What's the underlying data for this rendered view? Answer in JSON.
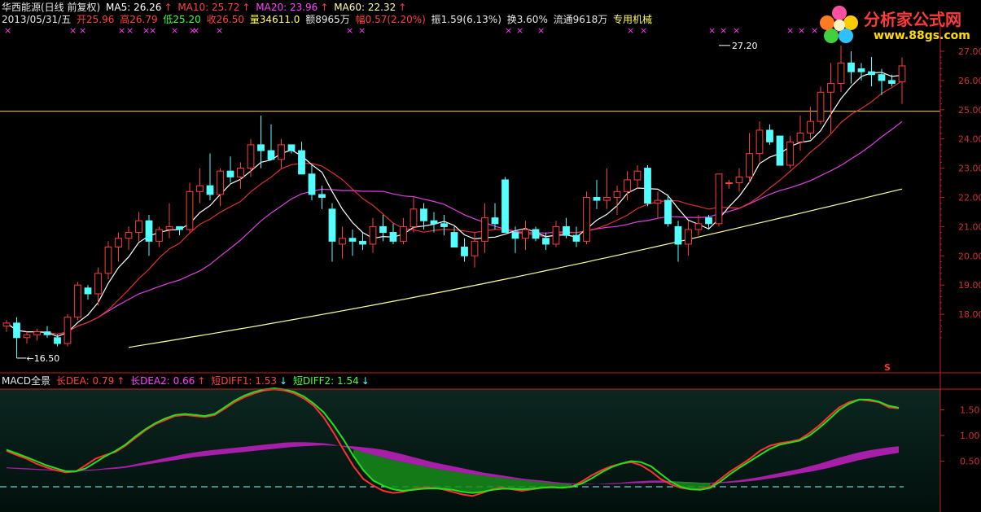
{
  "header": {
    "title": "华西能源(日线 前复权)",
    "ma5": "MA5: 26.26",
    "ma10": "MA10: 25.72",
    "ma20": "MA20: 23.96",
    "ma60": "MA60: 22.32",
    "date": "2013/05/31/五",
    "open": "开25.96",
    "high": "高26.79",
    "low": "低25.20",
    "close": "收26.50",
    "volume": "量34611.0",
    "amount": "额8965万",
    "change": "幅0.57(2.20%)",
    "amplitude": "振1.59(6.13%)",
    "turnover": "换3.60%",
    "float": "流通9618万",
    "sector": "专用机械"
  },
  "macd_header": {
    "title": "MACD全景",
    "long_dea": "长DEA: 0.79",
    "long_dea2": "长DEA2: 0.66",
    "short_diff1": "短DIFF1: 1.53",
    "short_diff2": "短DIFF2: 1.54"
  },
  "watermark": {
    "text": "分析家公式网",
    "url": "www.88gs.com"
  },
  "annotations": {
    "high_label": "27.20",
    "low_label": "16.50",
    "signal_mark": "S"
  },
  "colors": {
    "up": "#ff3c3c",
    "down": "#54ffff",
    "ma5": "#ffffff",
    "ma10": "#e03030",
    "ma20": "#e040e0",
    "ma60": "#ffffa0",
    "level_line": "#ffcc66",
    "axis": "#c02020",
    "diff1": "#ff3030",
    "diff2": "#20e020",
    "dea_long": "#b020b0",
    "zero_line": "#80ffff"
  },
  "chart_data": [
    {
      "type": "candlestick",
      "title": "华西能源(日线 前复权)",
      "ylim": [
        16.0,
        27.5
      ],
      "yticks": [
        "27.00",
        "26.00",
        "25.00",
        "24.00",
        "23.00",
        "22.00",
        "21.00",
        "20.00",
        "19.00",
        "18.00"
      ],
      "ytick_values": [
        27,
        26,
        25,
        24,
        23,
        22,
        21,
        20,
        19,
        18
      ],
      "horizontal_level": 24.95,
      "high_marker": {
        "index": 70,
        "value": 27.2
      },
      "low_marker": {
        "index": 1,
        "value": 16.5
      },
      "candles": [
        [
          17.6,
          17.8,
          17.4,
          17.7
        ],
        [
          17.7,
          17.9,
          16.5,
          17.2
        ],
        [
          17.2,
          17.4,
          17.0,
          17.3
        ],
        [
          17.3,
          17.5,
          17.1,
          17.4
        ],
        [
          17.4,
          17.6,
          17.2,
          17.3
        ],
        [
          17.2,
          17.3,
          16.9,
          17.0
        ],
        [
          17.0,
          18.0,
          16.9,
          17.9
        ],
        [
          17.9,
          19.1,
          17.8,
          19.0
        ],
        [
          18.9,
          19.0,
          18.5,
          18.7
        ],
        [
          18.7,
          19.6,
          18.3,
          19.4
        ],
        [
          19.4,
          20.5,
          19.2,
          20.3
        ],
        [
          20.3,
          20.8,
          19.8,
          20.6
        ],
        [
          20.6,
          21.0,
          20.2,
          20.8
        ],
        [
          20.8,
          21.5,
          20.5,
          21.2
        ],
        [
          21.2,
          21.4,
          20.0,
          20.5
        ],
        [
          20.5,
          21.0,
          20.3,
          20.9
        ],
        [
          20.9,
          21.8,
          20.6,
          21.0
        ],
        [
          21.0,
          21.0,
          20.7,
          20.9
        ],
        [
          20.9,
          22.5,
          20.8,
          22.2
        ],
        [
          22.2,
          23.0,
          21.8,
          22.4
        ],
        [
          22.4,
          23.5,
          21.9,
          22.1
        ],
        [
          22.1,
          23.0,
          21.7,
          22.9
        ],
        [
          22.9,
          23.4,
          22.5,
          22.7
        ],
        [
          22.7,
          23.2,
          22.3,
          23.0
        ],
        [
          23.0,
          24.0,
          22.7,
          23.8
        ],
        [
          23.8,
          24.8,
          23.0,
          23.6
        ],
        [
          23.6,
          24.5,
          23.3,
          23.3
        ],
        [
          23.3,
          24.0,
          23.0,
          23.8
        ],
        [
          23.8,
          23.8,
          23.5,
          23.6
        ],
        [
          23.6,
          23.9,
          22.8,
          22.8
        ],
        [
          22.8,
          23.1,
          21.9,
          22.1
        ],
        [
          22.1,
          22.4,
          21.6,
          22.0
        ],
        [
          21.6,
          21.8,
          19.8,
          20.5
        ],
        [
          20.4,
          21.0,
          19.9,
          20.6
        ],
        [
          20.6,
          20.9,
          20.0,
          20.5
        ],
        [
          20.5,
          20.8,
          20.2,
          20.4
        ],
        [
          20.4,
          21.3,
          20.1,
          21.0
        ],
        [
          21.0,
          21.4,
          20.5,
          20.8
        ],
        [
          20.8,
          21.1,
          20.4,
          20.5
        ],
        [
          20.5,
          21.3,
          20.4,
          21.0
        ],
        [
          21.0,
          22.0,
          20.8,
          21.6
        ],
        [
          21.6,
          21.8,
          20.9,
          21.2
        ],
        [
          21.2,
          21.5,
          20.8,
          21.1
        ],
        [
          21.1,
          21.4,
          20.7,
          21.0
        ],
        [
          20.8,
          21.0,
          20.3,
          20.3
        ],
        [
          20.3,
          20.6,
          19.8,
          20.0
        ],
        [
          20.0,
          20.8,
          19.6,
          20.5
        ],
        [
          20.5,
          21.8,
          20.1,
          21.3
        ],
        [
          21.3,
          21.8,
          20.9,
          21.1
        ],
        [
          22.6,
          22.7,
          20.8,
          20.8
        ],
        [
          20.8,
          21.0,
          20.1,
          20.6
        ],
        [
          20.6,
          21.2,
          20.2,
          20.9
        ],
        [
          20.9,
          21.0,
          20.5,
          20.6
        ],
        [
          20.6,
          20.8,
          20.2,
          20.4
        ],
        [
          20.4,
          21.2,
          20.3,
          21.0
        ],
        [
          21.0,
          21.3,
          20.6,
          20.7
        ],
        [
          20.7,
          21.0,
          20.3,
          20.5
        ],
        [
          20.5,
          22.2,
          20.4,
          22.0
        ],
        [
          22.0,
          22.6,
          21.6,
          21.9
        ],
        [
          21.9,
          23.0,
          21.6,
          22.0
        ],
        [
          22.0,
          22.4,
          21.4,
          22.2
        ],
        [
          22.2,
          22.9,
          21.9,
          22.6
        ],
        [
          22.6,
          23.1,
          22.3,
          22.9
        ],
        [
          23.0,
          23.1,
          21.7,
          21.8
        ],
        [
          21.8,
          22.2,
          21.3,
          21.9
        ],
        [
          21.9,
          22.1,
          21.0,
          21.1
        ],
        [
          21.0,
          21.2,
          19.8,
          20.4
        ],
        [
          20.4,
          21.2,
          20.0,
          20.9
        ],
        [
          20.9,
          21.4,
          20.7,
          21.1
        ],
        [
          21.3,
          21.4,
          20.9,
          21.1
        ],
        [
          21.1,
          22.8,
          21.0,
          22.8
        ],
        [
          22.5,
          22.6,
          22.3,
          22.5
        ],
        [
          22.5,
          23.0,
          22.2,
          22.7
        ],
        [
          22.7,
          24.2,
          22.5,
          23.5
        ],
        [
          23.5,
          24.6,
          23.2,
          24.3
        ],
        [
          24.3,
          24.5,
          23.8,
          23.9
        ],
        [
          24.1,
          24.1,
          23.1,
          23.1
        ],
        [
          23.1,
          24.1,
          23.0,
          23.9
        ],
        [
          23.9,
          24.8,
          23.6,
          24.2
        ],
        [
          24.2,
          25.1,
          24.0,
          24.6
        ],
        [
          24.6,
          25.8,
          24.5,
          25.6
        ],
        [
          25.6,
          26.6,
          24.2,
          25.9
        ],
        [
          25.9,
          27.2,
          25.6,
          26.6
        ],
        [
          26.6,
          27.0,
          25.9,
          26.3
        ],
        [
          26.4,
          26.6,
          26.0,
          26.3
        ],
        [
          26.3,
          26.8,
          25.8,
          26.2
        ],
        [
          26.2,
          26.4,
          25.5,
          26.0
        ],
        [
          26.0,
          26.2,
          25.8,
          25.9
        ],
        [
          25.96,
          26.79,
          25.2,
          26.5
        ]
      ],
      "series": [
        {
          "name": "MA5"
        },
        {
          "name": "MA10"
        },
        {
          "name": "MA20"
        },
        {
          "name": "MA60"
        }
      ]
    },
    {
      "type": "line",
      "title": "MACD全景",
      "ylim": [
        -0.2,
        2.0
      ],
      "yticks": [
        "1.50",
        "1.00",
        "0.50"
      ],
      "ytick_values": [
        1.5,
        1.0,
        0.5
      ],
      "zero_line": 0.0,
      "series": [
        {
          "name": "短DIFF1",
          "values": [
            0.7,
            0.62,
            0.55,
            0.45,
            0.38,
            0.32,
            0.28,
            0.3,
            0.42,
            0.55,
            0.62,
            0.68,
            0.8,
            0.95,
            1.1,
            1.22,
            1.3,
            1.38,
            1.4,
            1.38,
            1.36,
            1.4,
            1.52,
            1.65,
            1.75,
            1.82,
            1.88,
            1.9,
            1.88,
            1.82,
            1.72,
            1.58,
            1.35,
            1.05,
            0.72,
            0.4,
            0.15,
            0.02,
            -0.08,
            -0.12,
            -0.1,
            -0.05,
            -0.02,
            -0.02,
            -0.05,
            -0.1,
            -0.15,
            -0.18,
            -0.12,
            -0.05,
            -0.02,
            -0.05,
            -0.08,
            -0.05,
            -0.02,
            0.0,
            -0.02,
            0.0,
            0.1,
            0.22,
            0.32,
            0.4,
            0.45,
            0.48,
            0.42,
            0.3,
            0.15,
            0.05,
            -0.02,
            -0.05,
            -0.05,
            0.0,
            0.15,
            0.3,
            0.42,
            0.55,
            0.7,
            0.8,
            0.85,
            0.88,
            0.92,
            1.05,
            1.2,
            1.38,
            1.55,
            1.65,
            1.7,
            1.68,
            1.65,
            1.55,
            1.53
          ]
        },
        {
          "name": "短DIFF2",
          "values": [
            0.72,
            0.65,
            0.58,
            0.5,
            0.42,
            0.36,
            0.3,
            0.3,
            0.36,
            0.48,
            0.6,
            0.7,
            0.82,
            0.98,
            1.12,
            1.24,
            1.33,
            1.4,
            1.42,
            1.4,
            1.38,
            1.42,
            1.55,
            1.68,
            1.78,
            1.85,
            1.9,
            1.92,
            1.9,
            1.85,
            1.76,
            1.62,
            1.45,
            1.2,
            0.92,
            0.6,
            0.32,
            0.12,
            0.02,
            -0.05,
            -0.08,
            -0.06,
            -0.04,
            -0.03,
            -0.04,
            -0.06,
            -0.1,
            -0.12,
            -0.1,
            -0.06,
            -0.04,
            -0.04,
            -0.05,
            -0.04,
            -0.02,
            -0.01,
            -0.02,
            0.0,
            0.06,
            0.16,
            0.28,
            0.38,
            0.45,
            0.5,
            0.48,
            0.4,
            0.25,
            0.1,
            0.0,
            -0.05,
            -0.06,
            -0.02,
            0.1,
            0.25,
            0.38,
            0.5,
            0.62,
            0.74,
            0.82,
            0.86,
            0.9,
            1.0,
            1.15,
            1.32,
            1.5,
            1.62,
            1.7,
            1.7,
            1.66,
            1.58,
            1.54
          ]
        },
        {
          "name": "长DEA",
          "values": [
            0.38,
            0.37,
            0.36,
            0.35,
            0.34,
            0.33,
            0.32,
            0.32,
            0.33,
            0.34,
            0.36,
            0.38,
            0.4,
            0.44,
            0.48,
            0.52,
            0.56,
            0.6,
            0.64,
            0.67,
            0.7,
            0.72,
            0.74,
            0.76,
            0.78,
            0.8,
            0.82,
            0.84,
            0.86,
            0.87,
            0.87,
            0.86,
            0.85,
            0.82,
            0.78,
            0.73,
            0.67,
            0.62,
            0.57,
            0.52,
            0.48,
            0.44,
            0.4,
            0.36,
            0.33,
            0.3,
            0.27,
            0.24,
            0.22,
            0.19,
            0.17,
            0.15,
            0.13,
            0.11,
            0.09,
            0.07,
            0.06,
            0.05,
            0.05,
            0.05,
            0.06,
            0.07,
            0.08,
            0.1,
            0.11,
            0.12,
            0.12,
            0.11,
            0.1,
            0.09,
            0.08,
            0.08,
            0.09,
            0.11,
            0.13,
            0.16,
            0.19,
            0.23,
            0.27,
            0.31,
            0.35,
            0.4,
            0.45,
            0.51,
            0.57,
            0.62,
            0.67,
            0.71,
            0.74,
            0.77,
            0.79
          ]
        },
        {
          "name": "长DEA2",
          "values": [
            0.36,
            0.35,
            0.34,
            0.33,
            0.32,
            0.31,
            0.3,
            0.3,
            0.31,
            0.32,
            0.34,
            0.35,
            0.37,
            0.4,
            0.43,
            0.46,
            0.49,
            0.52,
            0.55,
            0.58,
            0.6,
            0.62,
            0.64,
            0.66,
            0.68,
            0.7,
            0.72,
            0.74,
            0.76,
            0.78,
            0.79,
            0.8,
            0.81,
            0.8,
            0.8,
            0.79,
            0.77,
            0.75,
            0.72,
            0.68,
            0.63,
            0.58,
            0.53,
            0.48,
            0.44,
            0.4,
            0.36,
            0.32,
            0.28,
            0.25,
            0.22,
            0.19,
            0.16,
            0.14,
            0.12,
            0.1,
            0.08,
            0.07,
            0.06,
            0.06,
            0.05,
            0.05,
            0.06,
            0.07,
            0.07,
            0.08,
            0.08,
            0.08,
            0.07,
            0.07,
            0.06,
            0.06,
            0.07,
            0.08,
            0.09,
            0.11,
            0.13,
            0.16,
            0.19,
            0.22,
            0.26,
            0.29,
            0.33,
            0.37,
            0.42,
            0.47,
            0.52,
            0.56,
            0.6,
            0.63,
            0.66
          ]
        }
      ]
    }
  ]
}
